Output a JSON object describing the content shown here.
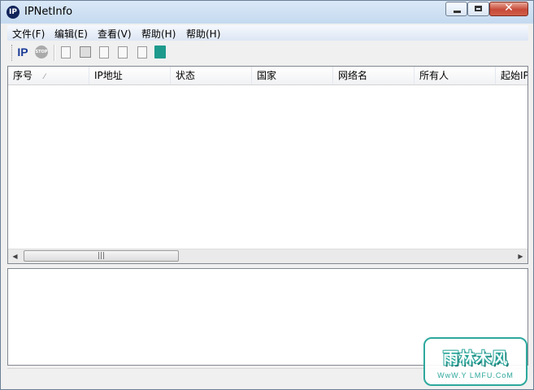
{
  "window": {
    "title": "IPNetInfo",
    "icon_label": "IP",
    "close_glyph": "✕"
  },
  "menu": [
    "文件(F)",
    "编辑(E)",
    "查看(V)",
    "帮助(H)",
    "帮助(H)"
  ],
  "toolbar": {
    "ip_label": "IP",
    "stop_label": "STOP",
    "icons": [
      "ip-lookup-icon",
      "stop-icon",
      "copy-document-icon",
      "save-icon",
      "copy-icon",
      "properties-icon",
      "html-report-icon",
      "exit-icon"
    ]
  },
  "table": {
    "columns": [
      "序号",
      "IP地址",
      "状态",
      "国家",
      "网络名",
      "所有人",
      "起始IP"
    ],
    "sorted_column": "序号",
    "sort_glyph": "⁄",
    "rows": []
  },
  "scrollbar": {
    "left_arrow": "◀",
    "right_arrow": "▶",
    "thumb_grip": "|||"
  },
  "watermark": {
    "title": "雨林木风",
    "url": "WwW.Y LMFU.CoM"
  },
  "colors": {
    "titlebar": "#c4d9ef",
    "close_button": "#c74a38",
    "watermark": "#2ea89d"
  }
}
